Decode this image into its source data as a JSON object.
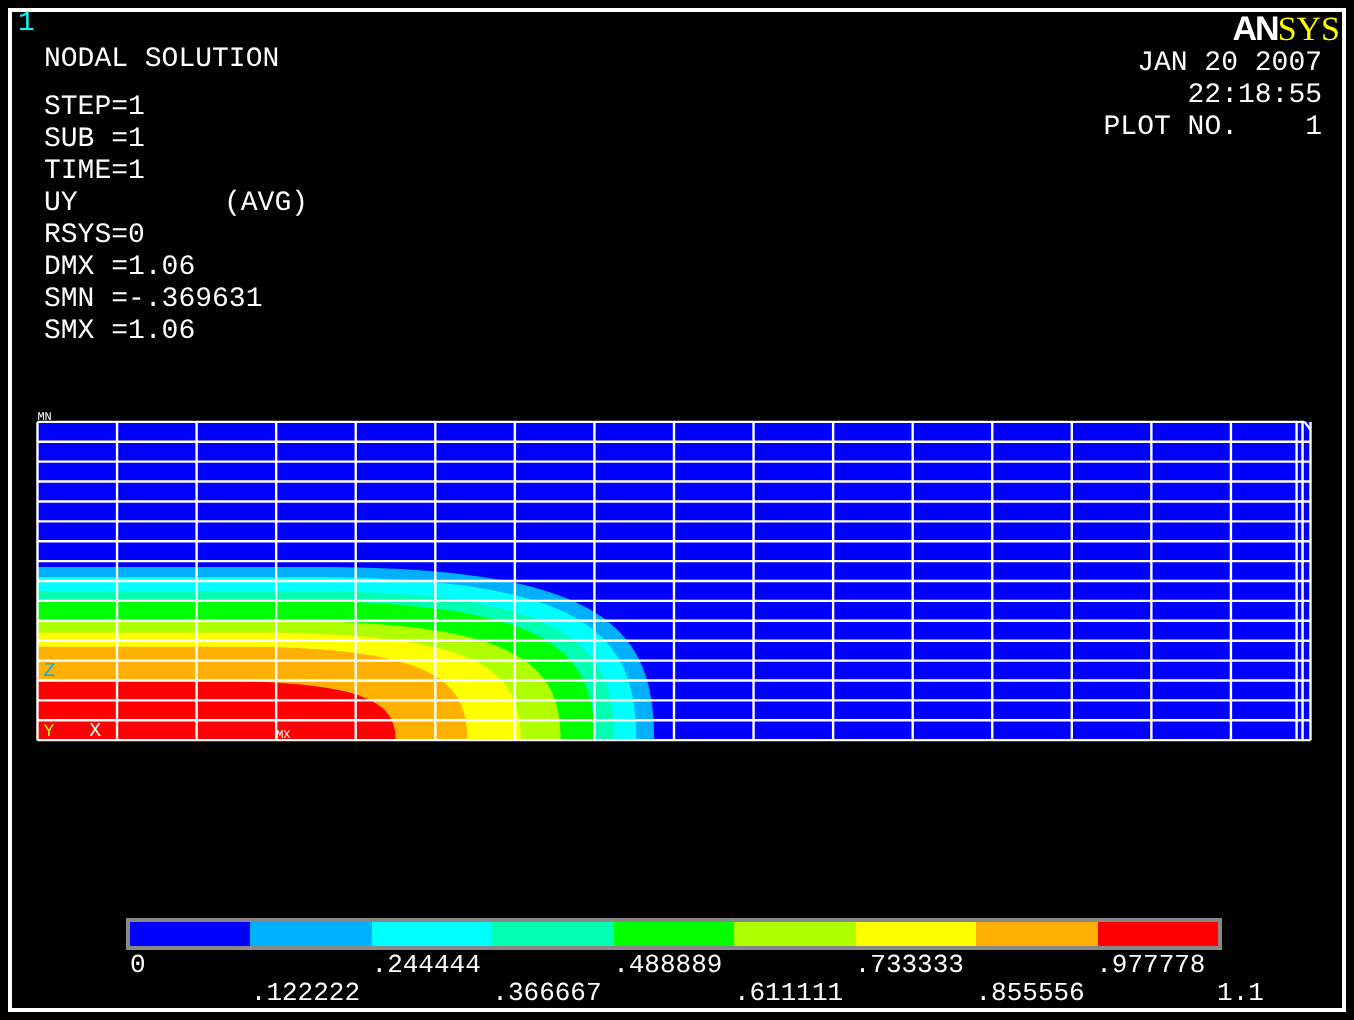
{
  "window_number": "1",
  "logo": {
    "primary": "AN",
    "accent": "SYS"
  },
  "title": "NODAL SOLUTION",
  "info_lines": [
    {
      "text": "STEP=1"
    },
    {
      "text": "SUB =1"
    },
    {
      "text": "TIME=1"
    },
    {
      "text": "UY",
      "note": "(AVG)"
    },
    {
      "text": "RSYS=0"
    },
    {
      "text": "DMX =1.06"
    },
    {
      "text": "SMN =-.369631"
    },
    {
      "text": "SMX =1.06"
    }
  ],
  "stamp": [
    "JAN 20 2007",
    "22:18:55",
    "PLOT NO.    1"
  ],
  "plot": {
    "min_label": "MN",
    "max_label": "MX",
    "triad": {
      "x": "X",
      "y": "Y",
      "z": "Z"
    }
  },
  "legend": {
    "bands": [
      {
        "color": "#0000ff"
      },
      {
        "color": "#00b0ff"
      },
      {
        "color": "#00ffff"
      },
      {
        "color": "#00ffb0"
      },
      {
        "color": "#00ff00"
      },
      {
        "color": "#b0ff00"
      },
      {
        "color": "#ffff00"
      },
      {
        "color": "#ffb000"
      },
      {
        "color": "#ff0000"
      }
    ],
    "labels": [
      "0",
      ".122222",
      ".244444",
      ".366667",
      ".488889",
      ".611111",
      ".733333",
      ".855556",
      ".977778",
      "1.1"
    ]
  }
}
